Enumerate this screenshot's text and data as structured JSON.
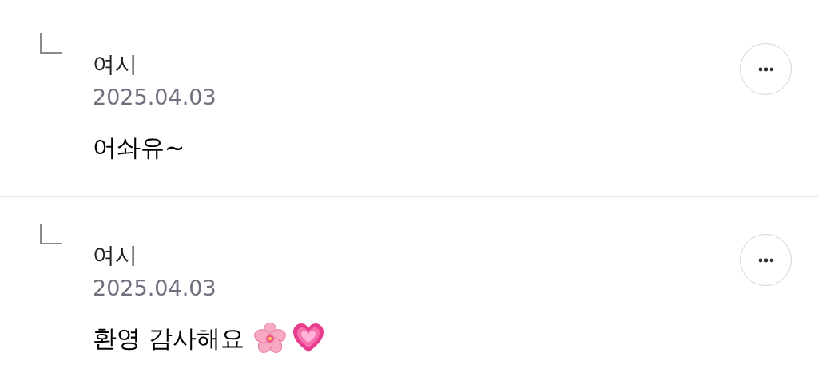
{
  "comments": [
    {
      "author": "여시",
      "date": "2025.04.03",
      "text": "어솨유~"
    },
    {
      "author": "여시",
      "date": "2025.04.03",
      "text": "환영 감사해요",
      "icons": [
        {
          "kind": "blossom"
        },
        {
          "kind": "heart"
        }
      ]
    }
  ]
}
